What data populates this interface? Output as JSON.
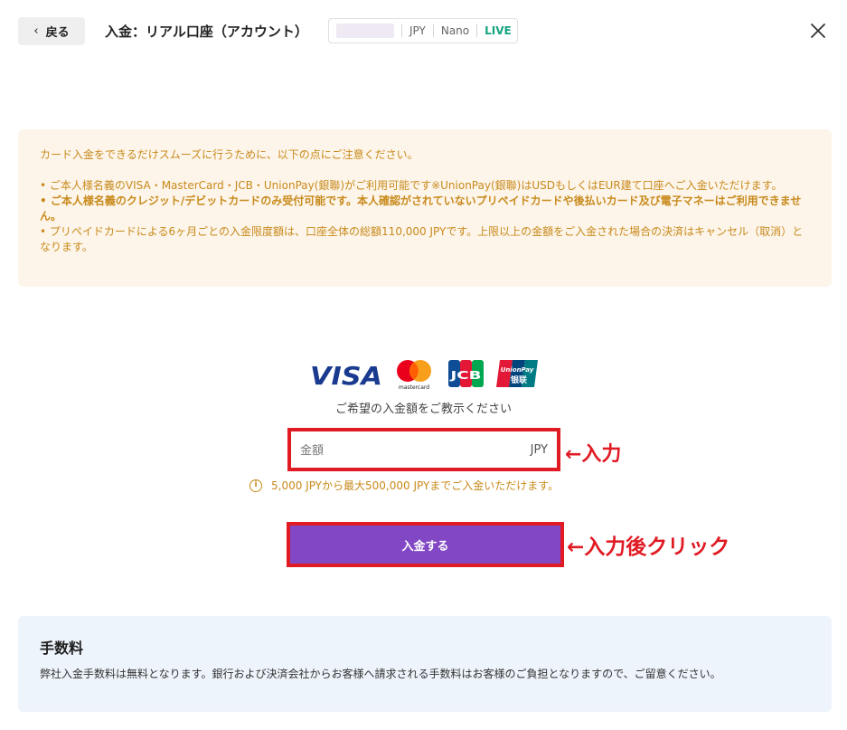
{
  "header": {
    "back_label": "戻る",
    "title": "入金：リアル口座（アカウント）",
    "account": {
      "currency": "JPY",
      "type": "Nano",
      "status": "LIVE"
    }
  },
  "notice": {
    "intro": "カード入金をできるだけスムーズに行うために、以下の点にご注意ください。",
    "item1": "• ご本人様名義のVISA・MasterCard・JCB・UnionPay(銀聯)がご利用可能です※UnionPay(銀聯)はUSDもしくはEUR建て口座へご入金いただけます。",
    "item2": "• ご本人様名義のクレジット/デビットカードのみ受付可能です。本人確認がされていないプリペイドカードや後払いカード及び電子マネーはご利用できません。",
    "item3": "• プリペイドカードによる6ヶ月ごとの入金限度額は、口座全体の総額110,000 JPYです。上限以上の金額をご入金された場合の決済はキャンセル（取消）となります。"
  },
  "card_logos": {
    "visa": "VISA",
    "mastercard": "mastercard",
    "jcb": "JCB",
    "unionpay": "UnionPay",
    "unionpay_cn": "银联"
  },
  "deposit": {
    "prompt": "ご希望の入金額をご教示ください",
    "amount_placeholder": "金額",
    "currency": "JPY",
    "limit_note": "5,000 JPYから最大500,000 JPYまでご入金いただけます。",
    "submit_label": "入金する"
  },
  "annotations": {
    "input": "←入力",
    "click": "←入力後クリック"
  },
  "fee": {
    "title": "手数料",
    "text": "弊社入金手数料は無料となります。銀行および決済会社からお客様へ請求される手数料はお客様のご負担となりますので、ご留意ください。"
  },
  "colors": {
    "accent": "#8247c4",
    "notice_bg": "#fdf5ea",
    "notice_text": "#c88a1c",
    "live": "#14a37f",
    "annotation": "#e01b24",
    "fee_bg": "#eef4fb"
  }
}
